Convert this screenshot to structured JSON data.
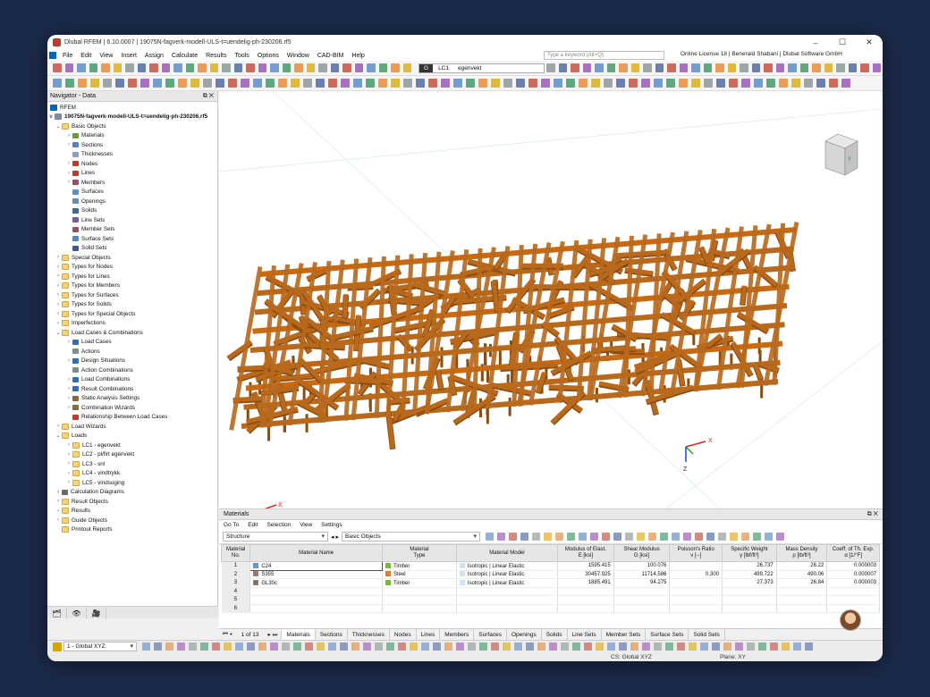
{
  "window": {
    "title": "Dlubal RFEM | 6.10.0007 | 19075N-fagverk-modell-ULS-t=uendelig-ph-230206.rf5"
  },
  "menu": [
    "File",
    "Edit",
    "View",
    "Insert",
    "Assign",
    "Calculate",
    "Results",
    "Tools",
    "Options",
    "Window",
    "CAD-BIM",
    "Help"
  ],
  "search": {
    "placeholder": "Type a keyword (Alt+Q)"
  },
  "license": "Online License 18 | Benerald Shabani | Dlubal Software GmbH",
  "loadcase": {
    "type": "G",
    "number": "LC1",
    "name": "egenvekt"
  },
  "navigator": {
    "title": "Navigator - Data",
    "root": "RFEM",
    "file": "19075N-fagverk-modell-ULS-t=uendelig-ph-230206.rf5",
    "items": [
      {
        "label": "Basic Objects",
        "level": 1,
        "arrow": "v",
        "icon": "folder"
      },
      {
        "label": "Materials",
        "level": 2,
        "arrow": ">",
        "icon": "materials"
      },
      {
        "label": "Sections",
        "level": 2,
        "arrow": ">",
        "icon": "sections"
      },
      {
        "label": "Thicknesses",
        "level": 2,
        "arrow": "",
        "icon": "thickness"
      },
      {
        "label": "Nodes",
        "level": 2,
        "arrow": ">",
        "icon": "node"
      },
      {
        "label": "Lines",
        "level": 2,
        "arrow": ">",
        "icon": "line"
      },
      {
        "label": "Members",
        "level": 2,
        "arrow": ">",
        "icon": "member"
      },
      {
        "label": "Surfaces",
        "level": 2,
        "arrow": "",
        "icon": "surface"
      },
      {
        "label": "Openings",
        "level": 2,
        "arrow": "",
        "icon": "opening"
      },
      {
        "label": "Solids",
        "level": 2,
        "arrow": "",
        "icon": "solid"
      },
      {
        "label": "Line Sets",
        "level": 2,
        "arrow": "",
        "icon": "lineset"
      },
      {
        "label": "Member Sets",
        "level": 2,
        "arrow": "",
        "icon": "memberset"
      },
      {
        "label": "Surface Sets",
        "level": 2,
        "arrow": "",
        "icon": "surfaceset"
      },
      {
        "label": "Solid Sets",
        "level": 2,
        "arrow": "",
        "icon": "solidset"
      },
      {
        "label": "Special Objects",
        "level": 1,
        "arrow": ">",
        "icon": "folder"
      },
      {
        "label": "Types for Nodes",
        "level": 1,
        "arrow": ">",
        "icon": "folder"
      },
      {
        "label": "Types for Lines",
        "level": 1,
        "arrow": ">",
        "icon": "folder"
      },
      {
        "label": "Types for Members",
        "level": 1,
        "arrow": ">",
        "icon": "folder"
      },
      {
        "label": "Types for Surfaces",
        "level": 1,
        "arrow": ">",
        "icon": "folder"
      },
      {
        "label": "Types for Solids",
        "level": 1,
        "arrow": ">",
        "icon": "folder"
      },
      {
        "label": "Types for Special Objects",
        "level": 1,
        "arrow": ">",
        "icon": "folder"
      },
      {
        "label": "Imperfections",
        "level": 1,
        "arrow": ">",
        "icon": "folder"
      },
      {
        "label": "Load Cases & Combinations",
        "level": 1,
        "arrow": "v",
        "icon": "folder"
      },
      {
        "label": "Load Cases",
        "level": 2,
        "arrow": ">",
        "icon": "loadcase"
      },
      {
        "label": "Actions",
        "level": 2,
        "arrow": "",
        "icon": "action"
      },
      {
        "label": "Design Situations",
        "level": 2,
        "arrow": ">",
        "icon": "design"
      },
      {
        "label": "Action Combinations",
        "level": 2,
        "arrow": "",
        "icon": "action"
      },
      {
        "label": "Load Combinations",
        "level": 2,
        "arrow": ">",
        "icon": "combo"
      },
      {
        "label": "Result Combinations",
        "level": 2,
        "arrow": ">",
        "icon": "combo"
      },
      {
        "label": "Static Analysis Settings",
        "level": 2,
        "arrow": ">",
        "icon": "settings"
      },
      {
        "label": "Combination Wizards",
        "level": 2,
        "arrow": ">",
        "icon": "wizard"
      },
      {
        "label": "Relationship Between Load Cases",
        "level": 2,
        "arrow": "",
        "icon": "relation"
      },
      {
        "label": "Load Wizards",
        "level": 1,
        "arrow": ">",
        "icon": "folder"
      },
      {
        "label": "Loads",
        "level": 1,
        "arrow": "v",
        "icon": "folder"
      },
      {
        "label": "LC1 - egenvekt",
        "level": 2,
        "arrow": ">",
        "icon": "folder"
      },
      {
        "label": "LC2 - pl/firt egenvekt",
        "level": 2,
        "arrow": ">",
        "icon": "folder"
      },
      {
        "label": "LC3 - snl",
        "level": 2,
        "arrow": ">",
        "icon": "folder"
      },
      {
        "label": "LC4 - vindtrykk",
        "level": 2,
        "arrow": ">",
        "icon": "folder"
      },
      {
        "label": "LC5 - vindsuging",
        "level": 2,
        "arrow": ">",
        "icon": "folder"
      },
      {
        "label": "Calculation Diagrams",
        "level": 1,
        "arrow": ">",
        "icon": "diagram"
      },
      {
        "label": "Result Objects",
        "level": 1,
        "arrow": ">",
        "icon": "folder"
      },
      {
        "label": "Results",
        "level": 1,
        "arrow": ">",
        "icon": "folder"
      },
      {
        "label": "Guide Objects",
        "level": 1,
        "arrow": ">",
        "icon": "folder"
      },
      {
        "label": "Printout Reports",
        "level": 1,
        "arrow": "",
        "icon": "folder"
      }
    ]
  },
  "axes": {
    "x": "X",
    "y": "Y",
    "z": "Z"
  },
  "panel": {
    "title": "Materials",
    "menu": [
      "Go To",
      "Edit",
      "Selection",
      "View",
      "Settings"
    ],
    "filter1": "Structure",
    "filter2": "Basic Objects",
    "columns": [
      "Material\nNo.",
      "Material Name",
      "Material\nType",
      "Material Model",
      "Modulus of Elast.\nE [ksi]",
      "Shear Modulus\nG [ksi]",
      "Poisson's Ratio\nν [--]",
      "Specific Weight\nγ [lbf/ft³]",
      "Mass Density\nρ [lb/ft³]",
      "Coeff. of Th. Exp.\nα [1/°F]"
    ],
    "rows": [
      {
        "no": "1",
        "name": "C24",
        "color": "#5aa0e6",
        "type": "Timber",
        "type_color": "#7dbb2e",
        "model": "Isotropic | Linear Elastic",
        "E": "1595.415",
        "G": "100.076",
        "nu": "",
        "gamma": "26.737",
        "rho": "26.22",
        "alpha": "0.000003"
      },
      {
        "no": "2",
        "name": "S355",
        "color": "#b06a5a",
        "type": "Steel",
        "type_color": "#e07a2c",
        "model": "Isotropic | Linear Elastic",
        "E": "30457.925",
        "G": "11714.586",
        "nu": "0.300",
        "gamma": "499.722",
        "rho": "490.06",
        "alpha": "0.000007"
      },
      {
        "no": "3",
        "name": "GL30c",
        "color": "#8a6a4a",
        "type": "Timber",
        "type_color": "#7dbb2e",
        "model": "Isotropic | Linear Elastic",
        "E": "1885.491",
        "G": "94.275",
        "nu": "",
        "gamma": "27.373",
        "rho": "26.84",
        "alpha": "0.000003"
      },
      {
        "no": "4",
        "name": "",
        "color": "",
        "type": "",
        "type_color": "",
        "model": "",
        "E": "",
        "G": "",
        "nu": "",
        "gamma": "",
        "rho": "",
        "alpha": ""
      },
      {
        "no": "5",
        "name": "",
        "color": "",
        "type": "",
        "type_color": "",
        "model": "",
        "E": "",
        "G": "",
        "nu": "",
        "gamma": "",
        "rho": "",
        "alpha": ""
      },
      {
        "no": "6",
        "name": "",
        "color": "",
        "type": "",
        "type_color": "",
        "model": "",
        "E": "",
        "G": "",
        "nu": "",
        "gamma": "",
        "rho": "",
        "alpha": ""
      }
    ],
    "pager": "1 of 13",
    "tabs": [
      "Materials",
      "Sections",
      "Thicknesses",
      "Nodes",
      "Lines",
      "Members",
      "Surfaces",
      "Openings",
      "Solids",
      "Line Sets",
      "Member Sets",
      "Surface Sets",
      "Solid Sets"
    ]
  },
  "status": {
    "coord_system": "1 - Global XYZ",
    "cs": "CS: Global XYZ",
    "plane": "Plane: XY"
  },
  "colors": {
    "timber": "#b8691c",
    "timber_dark": "#8a4c10",
    "accent": "#0067b8"
  }
}
